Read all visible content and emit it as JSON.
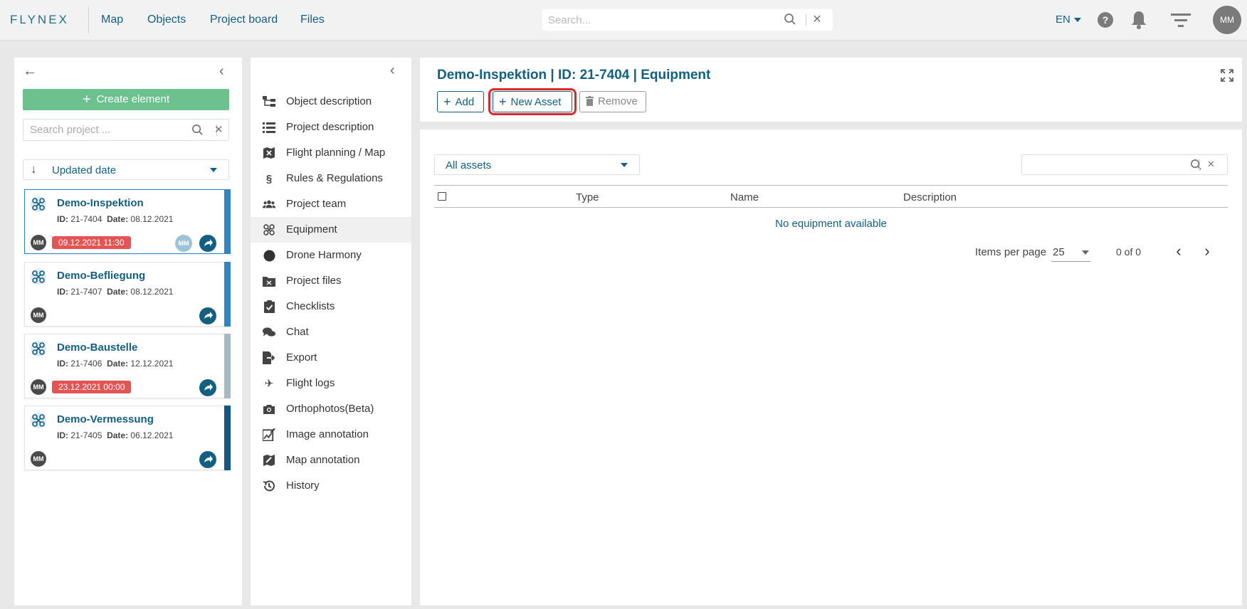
{
  "topbar": {
    "logo": "FLYNEX",
    "nav": [
      "Map",
      "Objects",
      "Project board",
      "Files"
    ],
    "search_placeholder": "Search...",
    "lang": "EN",
    "help": "?",
    "avatar": "MM"
  },
  "left": {
    "create_label": "Create element",
    "search_placeholder": "Search project ...",
    "sort_label": "Updated date",
    "cards": [
      {
        "title": "Demo-Inspektion",
        "id_label": "ID:",
        "id": "21-7404",
        "date_label": "Date:",
        "date": "08.12.2021",
        "avatar": "MM",
        "due": "09.12.2021 11:30",
        "assignee": "MM",
        "bar_color": "#2a86c8"
      },
      {
        "title": "Demo-Befliegung",
        "id_label": "ID:",
        "id": "21-7407",
        "date_label": "Date:",
        "date": "08.12.2021",
        "avatar": "MM",
        "due": "",
        "bar_color": "#2a86c8"
      },
      {
        "title": "Demo-Baustelle",
        "id_label": "ID:",
        "id": "21-7406",
        "date_label": "Date:",
        "date": "12.12.2021",
        "avatar": "MM",
        "due": "23.12.2021 00:00",
        "bar_color": "#a8b9c4"
      },
      {
        "title": "Demo-Vermessung",
        "id_label": "ID:",
        "id": "21-7405",
        "date_label": "Date:",
        "date": "06.12.2021",
        "avatar": "MM",
        "due": "",
        "bar_color": "#0d5a80"
      }
    ]
  },
  "menu": {
    "items": [
      {
        "label": "Object description",
        "icon": "sitemap-icon"
      },
      {
        "label": "Project description",
        "icon": "list-icon"
      },
      {
        "label": "Flight planning / Map",
        "icon": "map-drone-icon"
      },
      {
        "label": "Rules & Regulations",
        "icon": "section-icon"
      },
      {
        "label": "Project team",
        "icon": "team-icon"
      },
      {
        "label": "Equipment",
        "icon": "drone-icon",
        "active": true
      },
      {
        "label": "Drone Harmony",
        "icon": "circle-icon"
      },
      {
        "label": "Project files",
        "icon": "folder-icon"
      },
      {
        "label": "Checklists",
        "icon": "clipboard-check-icon"
      },
      {
        "label": "Chat",
        "icon": "chat-icon"
      },
      {
        "label": "Export",
        "icon": "export-icon"
      },
      {
        "label": "Flight logs",
        "icon": "plane-icon"
      },
      {
        "label": "Orthophotos(Beta)",
        "icon": "camera-icon"
      },
      {
        "label": "Image annotation",
        "icon": "image-annotation-icon"
      },
      {
        "label": "Map annotation",
        "icon": "map-annotation-icon"
      },
      {
        "label": "History",
        "icon": "history-icon"
      }
    ]
  },
  "content": {
    "title": "Demo-Inspektion | ID: 21-7404 | Equipment",
    "add_label": "Add",
    "new_asset_label": "New Asset",
    "remove_label": "Remove",
    "filter_label": "All assets",
    "columns": [
      "Type",
      "Name",
      "Description"
    ],
    "empty_text": "No equipment available",
    "items_per_page_label": "Items per page",
    "page_size": "25",
    "range": "0 of 0"
  },
  "colors": {
    "brand": "#135f82",
    "create": "#6cc18f",
    "due": "#e35454",
    "highlight": "#e0252b"
  }
}
